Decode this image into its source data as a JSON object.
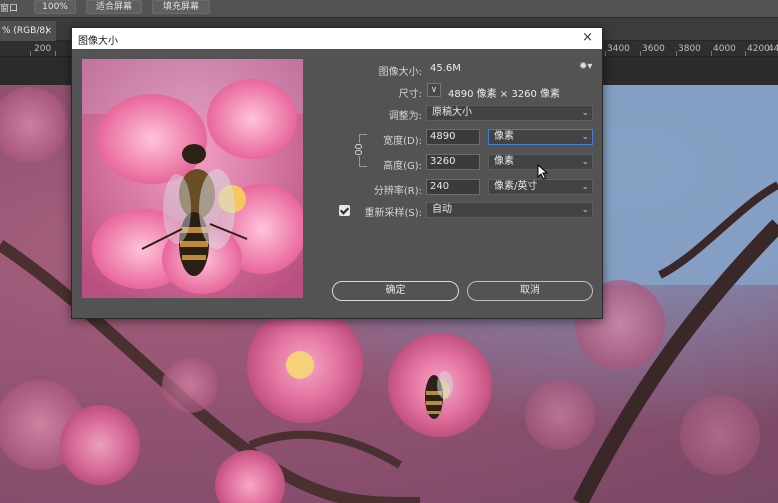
{
  "options_bar": {
    "left_fragment": "窗口",
    "zoom": "100%",
    "fit_screen": "适合屏幕",
    "fill_screen": "填充屏幕"
  },
  "doc_tab": {
    "label": "% (RGB/8)",
    "close": "×"
  },
  "ruler": {
    "labels": [
      "200",
      "3400",
      "3600",
      "3800",
      "4000",
      "4200",
      "44"
    ]
  },
  "dialog": {
    "title": "图像大小",
    "close": "×",
    "image_size_label": "图像大小:",
    "image_size_value": "45.6M",
    "dimensions_label": "尺寸:",
    "dimensions_value": "4890 像素 × 3260 像素",
    "fit_to_label": "调整为:",
    "fit_to_value": "原稿大小",
    "width_label": "宽度(D):",
    "width_value": "4890",
    "width_unit": "像素",
    "height_label": "高度(G):",
    "height_value": "3260",
    "height_unit": "像素",
    "resolution_label": "分辨率(R):",
    "resolution_value": "240",
    "resolution_unit": "像素/英寸",
    "resample_label": "重新采样(S):",
    "resample_checked": true,
    "resample_value": "自动",
    "ok_label": "确定",
    "cancel_label": "取消"
  },
  "colors": {
    "panel": "#535353",
    "focus": "#3f7fdc",
    "blossom": "#e07aa5",
    "sky": "#8fb3d6"
  },
  "icons": [
    "gear-icon",
    "chevron-down-icon",
    "link-icon",
    "close-icon",
    "checkbox-icon",
    "cursor-icon"
  ]
}
